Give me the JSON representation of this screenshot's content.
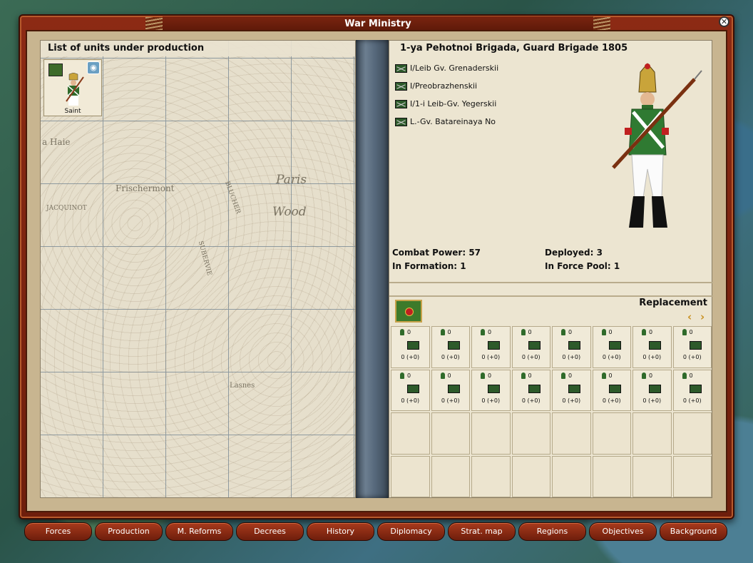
{
  "window": {
    "title": "War Ministry"
  },
  "left_panel": {
    "title": "List of units under production",
    "cards": [
      {
        "label": "Saint"
      }
    ],
    "map_labels": [
      "a Haie",
      "Frischermont",
      "Paris",
      "Wood",
      "JACQUINOT",
      "BLUCHER",
      "SUBERVIE",
      "Lasnes"
    ]
  },
  "right_panel": {
    "brigade_title": "1-ya Pehotnoi Brigada, Guard Brigade 1805",
    "sub_units": [
      "I/Leib Gv. Grenaderskii",
      "I/Preobrazhenskii",
      "I/1-i Leib-Gv. Yegerskii",
      "L.-Gv. Batareinaya No"
    ],
    "stats": {
      "combat_power": "Combat Power: 57",
      "deployed": "Deployed: 3",
      "in_formation": "In Formation: 1",
      "in_force_pool": "In Force Pool: 1"
    },
    "replacement_label": "Replacement",
    "replacement_cells": [
      {
        "count": "0",
        "value": "0 (+0)"
      },
      {
        "count": "0",
        "value": "0 (+0)"
      },
      {
        "count": "0",
        "value": "0 (+0)"
      },
      {
        "count": "0",
        "value": "0 (+0)"
      },
      {
        "count": "0",
        "value": "0 (+0)"
      },
      {
        "count": "0",
        "value": "0 (+0)"
      },
      {
        "count": "0",
        "value": "0 (+0)"
      },
      {
        "count": "0",
        "value": "0 (+0)"
      },
      {
        "count": "0",
        "value": "0 (+0)"
      },
      {
        "count": "0",
        "value": "0 (+0)"
      },
      {
        "count": "0",
        "value": "0 (+0)"
      },
      {
        "count": "0",
        "value": "0 (+0)"
      },
      {
        "count": "0",
        "value": "0 (+0)"
      },
      {
        "count": "0",
        "value": "0 (+0)"
      },
      {
        "count": "0",
        "value": "0 (+0)"
      },
      {
        "count": "0",
        "value": "0 (+0)"
      }
    ]
  },
  "nav_buttons": [
    "Forces",
    "Production",
    "M. Reforms",
    "Decrees",
    "History",
    "Diplomacy",
    "Strat. map",
    "Regions",
    "Objectives",
    "Background"
  ],
  "colors": {
    "frame": "#8c2a14",
    "panel": "#ece5d1",
    "unit_green": "#2d5a2a"
  }
}
